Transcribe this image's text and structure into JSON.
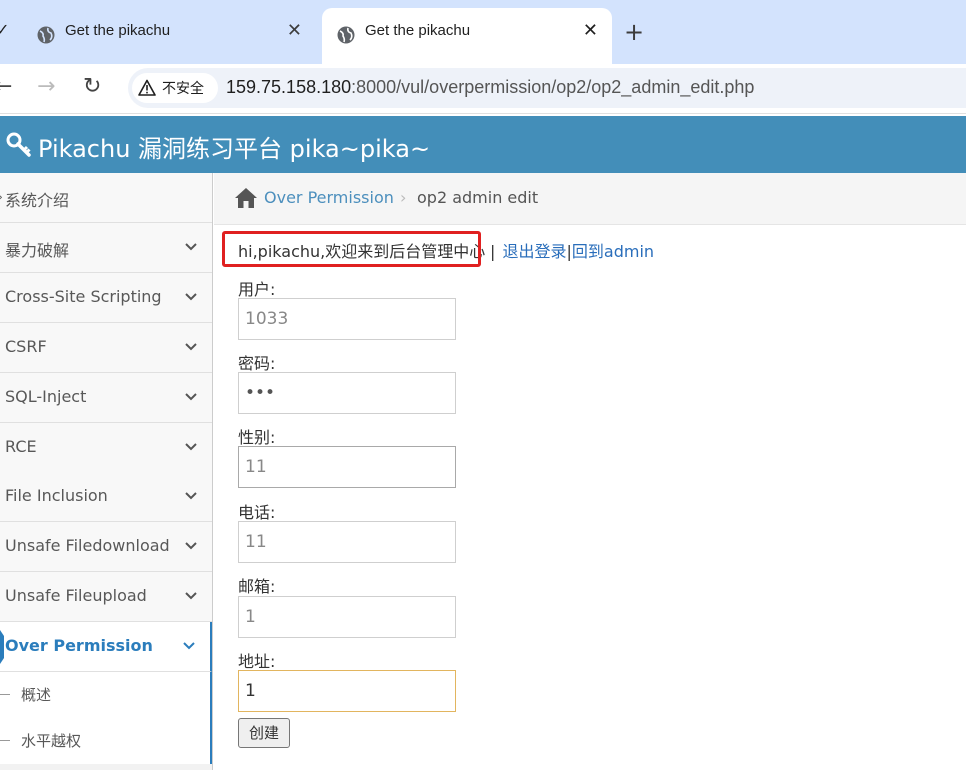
{
  "browser": {
    "tabs": [
      {
        "title": "Get the pikachu",
        "active": false
      },
      {
        "title": "Get the pikachu",
        "active": true
      }
    ],
    "security_label": "不安全",
    "url_host": "159.75.158.180",
    "url_path": ":8000/vul/overpermission/op2/op2_admin_edit.php"
  },
  "header": {
    "title": "Pikachu 漏洞练习平台 pika~pika~"
  },
  "sidebar": {
    "items": [
      {
        "label": "系统介绍"
      },
      {
        "label": "暴力破解"
      },
      {
        "label": "Cross-Site Scripting"
      },
      {
        "label": "CSRF"
      },
      {
        "label": "SQL-Inject"
      },
      {
        "label": "RCE"
      },
      {
        "label": "File Inclusion"
      },
      {
        "label": "Unsafe Filedownload"
      },
      {
        "label": "Unsafe Fileupload"
      },
      {
        "label": "Over Permission"
      }
    ],
    "subitems": [
      {
        "label": "概述"
      },
      {
        "label": "水平越权"
      }
    ]
  },
  "breadcrumb": {
    "parent": "Over Permission",
    "separator": "›",
    "current": "op2 admin edit"
  },
  "main": {
    "welcome": "hi,pikachu,欢迎来到后台管理中心",
    "sep1": "|",
    "logout": "退出登录",
    "sep2": "|",
    "back_admin": "回到admin",
    "fields": [
      {
        "label": "用户:",
        "value": "1033"
      },
      {
        "label": "密码:",
        "value": "•••"
      },
      {
        "label": "性别:",
        "value": "11"
      },
      {
        "label": "电话:",
        "value": "11"
      },
      {
        "label": "邮箱:",
        "value": "1"
      },
      {
        "label": "地址:",
        "value": "1"
      }
    ],
    "submit": "创建"
  },
  "colors": {
    "header_bg": "#438eb9",
    "tabstrip_bg": "#d3e3fd",
    "link": "#2a6ebb",
    "active_nav": "#2b7dbc",
    "highlight_border": "#e02020"
  }
}
